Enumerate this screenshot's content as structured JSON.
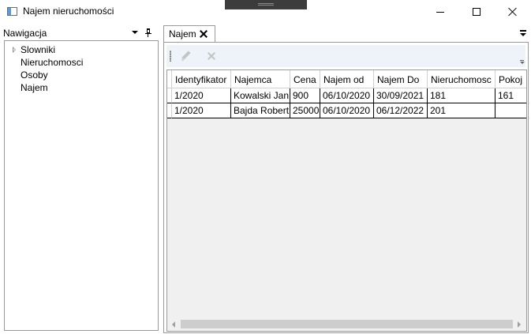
{
  "window": {
    "title": "Najem nieruchomości"
  },
  "navigation": {
    "title": "Nawigacja",
    "items": [
      {
        "label": "Slowniki",
        "expandable": true
      },
      {
        "label": "Nieruchomosci",
        "expandable": false
      },
      {
        "label": "Osoby",
        "expandable": false
      },
      {
        "label": "Najem",
        "expandable": false
      }
    ]
  },
  "document": {
    "tab_label": "Najem"
  },
  "toolbar": {
    "edit_icon": "pencil-icon",
    "delete_icon": "delete-x-icon",
    "enabled": false
  },
  "grid": {
    "columns": [
      "Identyfikator",
      "Najemca",
      "Cena",
      "Najem od",
      "Najem Do",
      "Nieruchomosc",
      "Pokoj"
    ],
    "rows": [
      [
        "1/2020",
        "Kowalski Jan",
        "900",
        "06/10/2020",
        "30/09/2021",
        "181",
        "161"
      ],
      [
        "1/2020",
        "Bajda Robert",
        "25000",
        "06/10/2020",
        "06/12/2022",
        "201",
        ""
      ]
    ]
  }
}
